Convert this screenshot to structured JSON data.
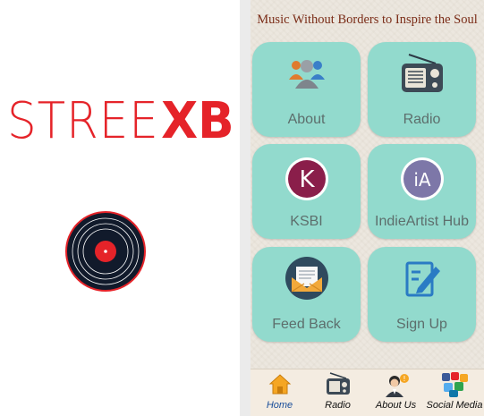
{
  "splash": {
    "logo_part1": "STREE",
    "logo_part2": "XB"
  },
  "app": {
    "tagline": "Music Without Borders to Inspire the Soul",
    "tiles": [
      {
        "label": "About",
        "icon": "people-icon"
      },
      {
        "label": "Radio",
        "icon": "radio-icon"
      },
      {
        "label": "KSBI",
        "icon": "ksbi-logo-icon",
        "badge": "K"
      },
      {
        "label": "IndieArtist Hub",
        "icon": "indieartist-logo-icon",
        "badge": "iA"
      },
      {
        "label": "Feed Back",
        "icon": "envelope-icon"
      },
      {
        "label": "Sign Up",
        "icon": "signup-pen-icon"
      }
    ],
    "tabs": [
      {
        "label": "Home",
        "icon": "home-icon",
        "active": true
      },
      {
        "label": "Radio",
        "icon": "radio-icon",
        "active": false
      },
      {
        "label": "About Us",
        "icon": "person-info-icon",
        "active": false
      },
      {
        "label": "Social Media",
        "icon": "social-media-icon",
        "active": false
      }
    ]
  },
  "colors": {
    "brand_red": "#e52329",
    "tile_teal": "#92dacd",
    "tagline_brown": "#7b2d18",
    "active_tab_blue": "#1a4e9a"
  }
}
